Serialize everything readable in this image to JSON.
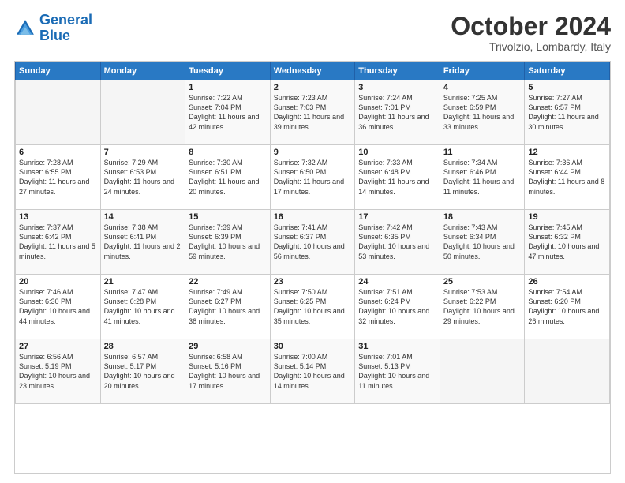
{
  "logo": {
    "line1": "General",
    "line2": "Blue"
  },
  "title": "October 2024",
  "subtitle": "Trivolzio, Lombardy, Italy",
  "weekdays": [
    "Sunday",
    "Monday",
    "Tuesday",
    "Wednesday",
    "Thursday",
    "Friday",
    "Saturday"
  ],
  "weeks": [
    [
      {
        "day": "",
        "sunrise": "",
        "sunset": "",
        "daylight": ""
      },
      {
        "day": "",
        "sunrise": "",
        "sunset": "",
        "daylight": ""
      },
      {
        "day": "1",
        "sunrise": "Sunrise: 7:22 AM",
        "sunset": "Sunset: 7:04 PM",
        "daylight": "Daylight: 11 hours and 42 minutes."
      },
      {
        "day": "2",
        "sunrise": "Sunrise: 7:23 AM",
        "sunset": "Sunset: 7:03 PM",
        "daylight": "Daylight: 11 hours and 39 minutes."
      },
      {
        "day": "3",
        "sunrise": "Sunrise: 7:24 AM",
        "sunset": "Sunset: 7:01 PM",
        "daylight": "Daylight: 11 hours and 36 minutes."
      },
      {
        "day": "4",
        "sunrise": "Sunrise: 7:25 AM",
        "sunset": "Sunset: 6:59 PM",
        "daylight": "Daylight: 11 hours and 33 minutes."
      },
      {
        "day": "5",
        "sunrise": "Sunrise: 7:27 AM",
        "sunset": "Sunset: 6:57 PM",
        "daylight": "Daylight: 11 hours and 30 minutes."
      }
    ],
    [
      {
        "day": "6",
        "sunrise": "Sunrise: 7:28 AM",
        "sunset": "Sunset: 6:55 PM",
        "daylight": "Daylight: 11 hours and 27 minutes."
      },
      {
        "day": "7",
        "sunrise": "Sunrise: 7:29 AM",
        "sunset": "Sunset: 6:53 PM",
        "daylight": "Daylight: 11 hours and 24 minutes."
      },
      {
        "day": "8",
        "sunrise": "Sunrise: 7:30 AM",
        "sunset": "Sunset: 6:51 PM",
        "daylight": "Daylight: 11 hours and 20 minutes."
      },
      {
        "day": "9",
        "sunrise": "Sunrise: 7:32 AM",
        "sunset": "Sunset: 6:50 PM",
        "daylight": "Daylight: 11 hours and 17 minutes."
      },
      {
        "day": "10",
        "sunrise": "Sunrise: 7:33 AM",
        "sunset": "Sunset: 6:48 PM",
        "daylight": "Daylight: 11 hours and 14 minutes."
      },
      {
        "day": "11",
        "sunrise": "Sunrise: 7:34 AM",
        "sunset": "Sunset: 6:46 PM",
        "daylight": "Daylight: 11 hours and 11 minutes."
      },
      {
        "day": "12",
        "sunrise": "Sunrise: 7:36 AM",
        "sunset": "Sunset: 6:44 PM",
        "daylight": "Daylight: 11 hours and 8 minutes."
      }
    ],
    [
      {
        "day": "13",
        "sunrise": "Sunrise: 7:37 AM",
        "sunset": "Sunset: 6:42 PM",
        "daylight": "Daylight: 11 hours and 5 minutes."
      },
      {
        "day": "14",
        "sunrise": "Sunrise: 7:38 AM",
        "sunset": "Sunset: 6:41 PM",
        "daylight": "Daylight: 11 hours and 2 minutes."
      },
      {
        "day": "15",
        "sunrise": "Sunrise: 7:39 AM",
        "sunset": "Sunset: 6:39 PM",
        "daylight": "Daylight: 10 hours and 59 minutes."
      },
      {
        "day": "16",
        "sunrise": "Sunrise: 7:41 AM",
        "sunset": "Sunset: 6:37 PM",
        "daylight": "Daylight: 10 hours and 56 minutes."
      },
      {
        "day": "17",
        "sunrise": "Sunrise: 7:42 AM",
        "sunset": "Sunset: 6:35 PM",
        "daylight": "Daylight: 10 hours and 53 minutes."
      },
      {
        "day": "18",
        "sunrise": "Sunrise: 7:43 AM",
        "sunset": "Sunset: 6:34 PM",
        "daylight": "Daylight: 10 hours and 50 minutes."
      },
      {
        "day": "19",
        "sunrise": "Sunrise: 7:45 AM",
        "sunset": "Sunset: 6:32 PM",
        "daylight": "Daylight: 10 hours and 47 minutes."
      }
    ],
    [
      {
        "day": "20",
        "sunrise": "Sunrise: 7:46 AM",
        "sunset": "Sunset: 6:30 PM",
        "daylight": "Daylight: 10 hours and 44 minutes."
      },
      {
        "day": "21",
        "sunrise": "Sunrise: 7:47 AM",
        "sunset": "Sunset: 6:28 PM",
        "daylight": "Daylight: 10 hours and 41 minutes."
      },
      {
        "day": "22",
        "sunrise": "Sunrise: 7:49 AM",
        "sunset": "Sunset: 6:27 PM",
        "daylight": "Daylight: 10 hours and 38 minutes."
      },
      {
        "day": "23",
        "sunrise": "Sunrise: 7:50 AM",
        "sunset": "Sunset: 6:25 PM",
        "daylight": "Daylight: 10 hours and 35 minutes."
      },
      {
        "day": "24",
        "sunrise": "Sunrise: 7:51 AM",
        "sunset": "Sunset: 6:24 PM",
        "daylight": "Daylight: 10 hours and 32 minutes."
      },
      {
        "day": "25",
        "sunrise": "Sunrise: 7:53 AM",
        "sunset": "Sunset: 6:22 PM",
        "daylight": "Daylight: 10 hours and 29 minutes."
      },
      {
        "day": "26",
        "sunrise": "Sunrise: 7:54 AM",
        "sunset": "Sunset: 6:20 PM",
        "daylight": "Daylight: 10 hours and 26 minutes."
      }
    ],
    [
      {
        "day": "27",
        "sunrise": "Sunrise: 6:56 AM",
        "sunset": "Sunset: 5:19 PM",
        "daylight": "Daylight: 10 hours and 23 minutes."
      },
      {
        "day": "28",
        "sunrise": "Sunrise: 6:57 AM",
        "sunset": "Sunset: 5:17 PM",
        "daylight": "Daylight: 10 hours and 20 minutes."
      },
      {
        "day": "29",
        "sunrise": "Sunrise: 6:58 AM",
        "sunset": "Sunset: 5:16 PM",
        "daylight": "Daylight: 10 hours and 17 minutes."
      },
      {
        "day": "30",
        "sunrise": "Sunrise: 7:00 AM",
        "sunset": "Sunset: 5:14 PM",
        "daylight": "Daylight: 10 hours and 14 minutes."
      },
      {
        "day": "31",
        "sunrise": "Sunrise: 7:01 AM",
        "sunset": "Sunset: 5:13 PM",
        "daylight": "Daylight: 10 hours and 11 minutes."
      },
      {
        "day": "",
        "sunrise": "",
        "sunset": "",
        "daylight": ""
      },
      {
        "day": "",
        "sunrise": "",
        "sunset": "",
        "daylight": ""
      }
    ]
  ]
}
